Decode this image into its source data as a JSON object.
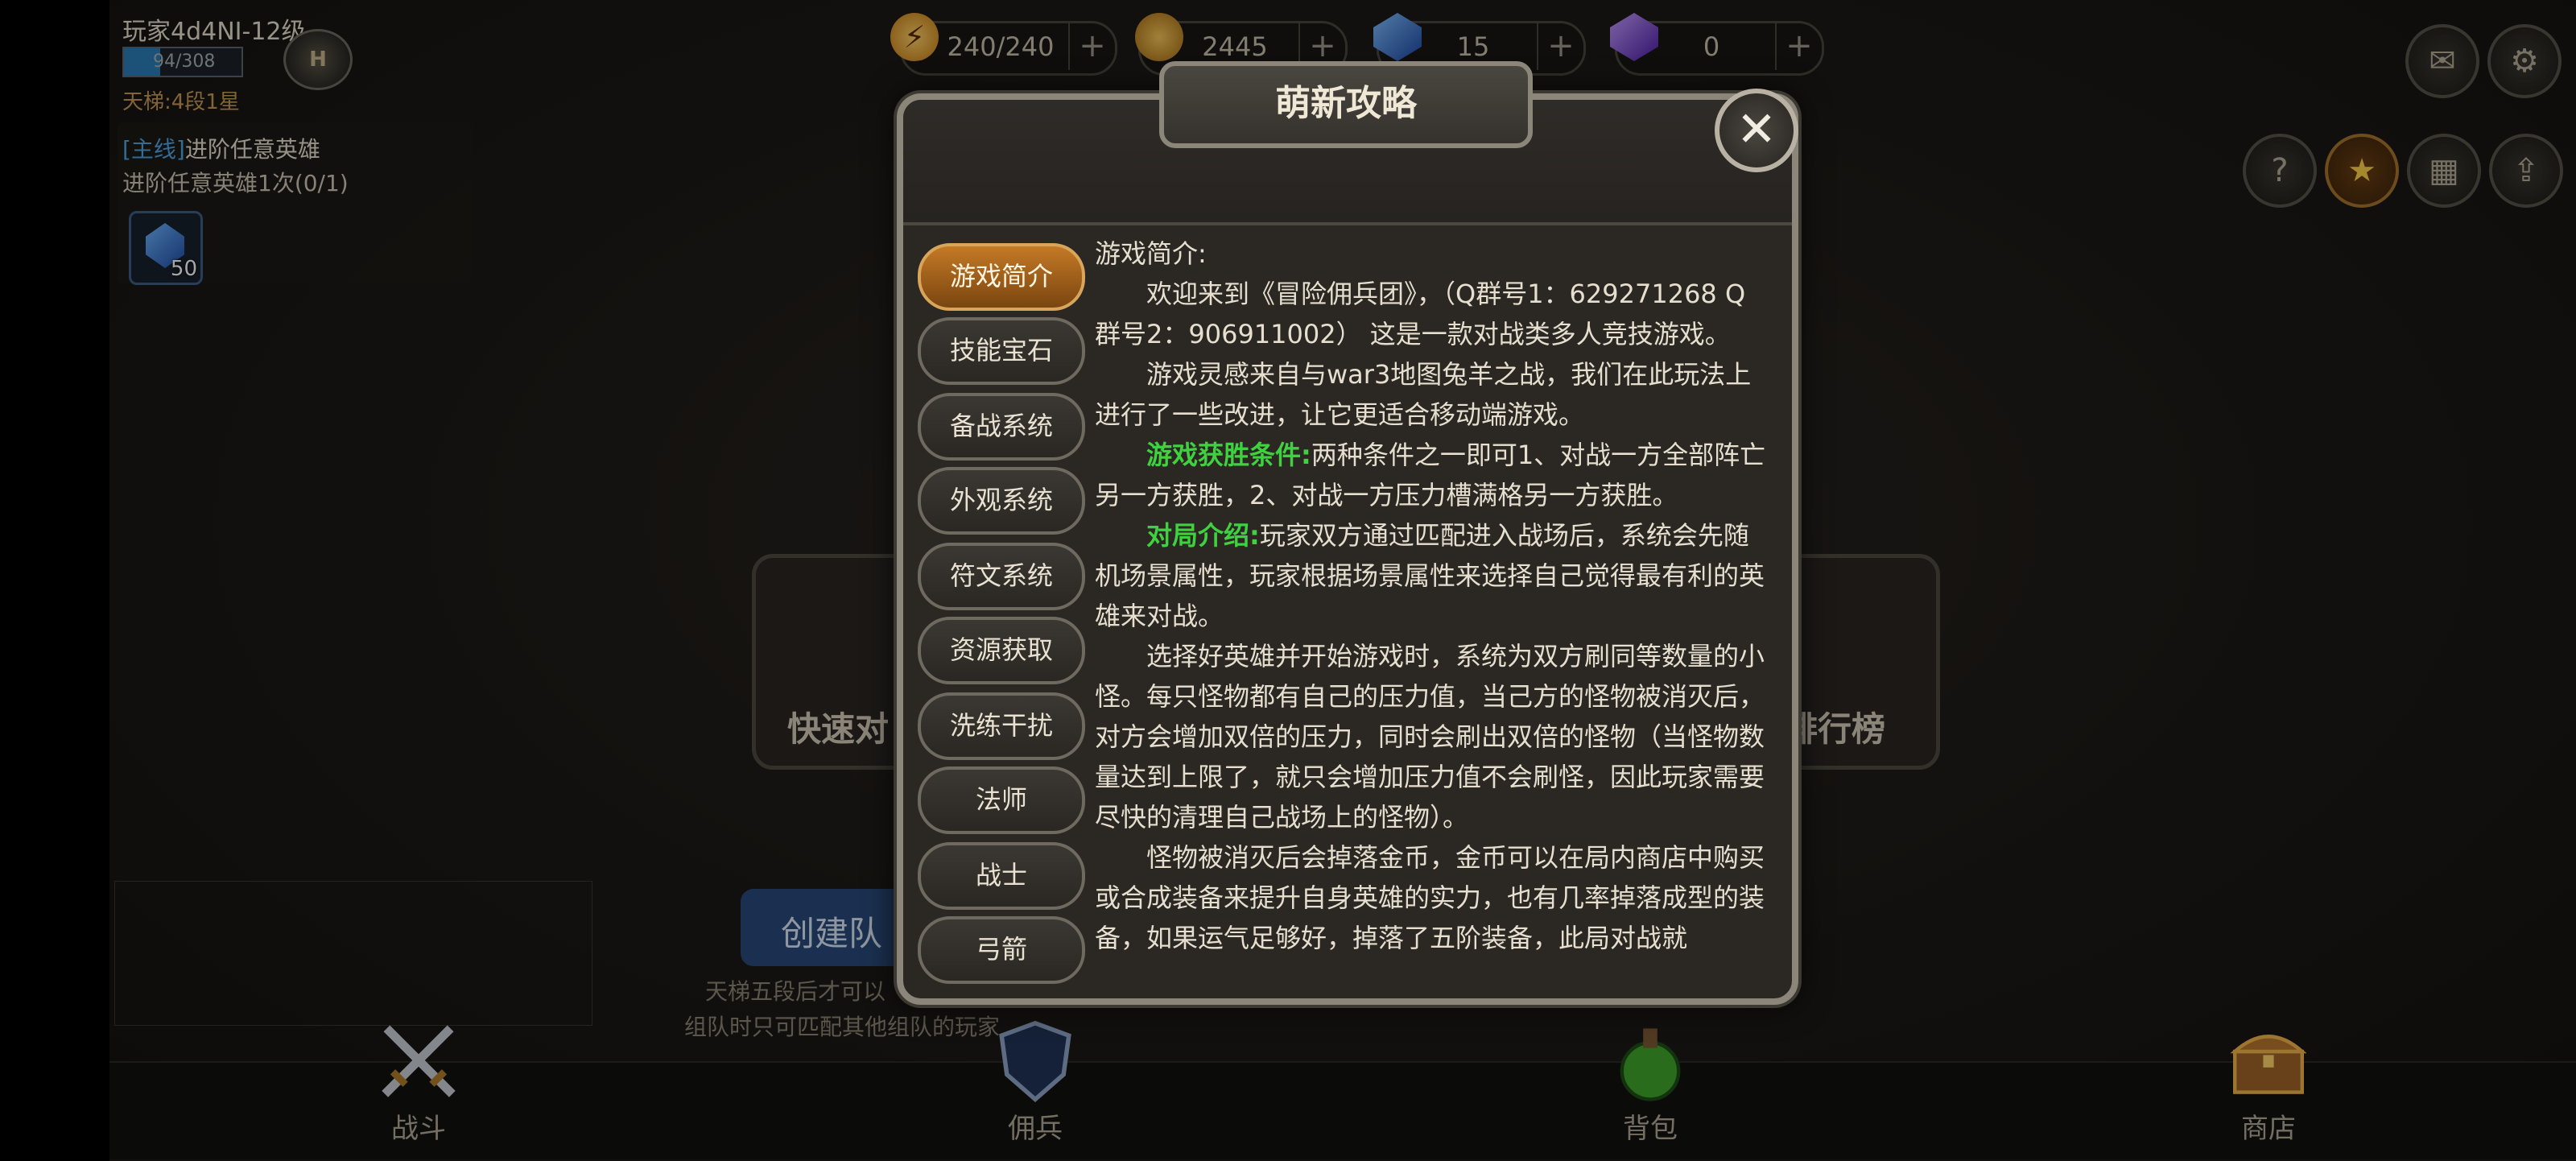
{
  "player": {
    "name": "玩家4d4NI-12级",
    "xp_text": "94/308",
    "xp_fraction": 0.305,
    "rank_badge": "H",
    "ladder": "天梯:4段1星"
  },
  "quest": {
    "tag": "[主线]",
    "title": "进阶任意英雄",
    "desc": "进阶任意英雄1次(0/1)",
    "reward_count": "50"
  },
  "resources": [
    {
      "icon": "energy-icon",
      "value": "240/240",
      "plus": "+"
    },
    {
      "icon": "gold-coin-icon",
      "value": "2445",
      "plus": "+"
    },
    {
      "icon": "blue-gem-icon",
      "value": "15",
      "plus": "+"
    },
    {
      "icon": "purple-gem-icon",
      "value": "0",
      "plus": "+"
    }
  ],
  "top_right_buttons": [
    "mail-icon",
    "settings-icon"
  ],
  "side_buttons": [
    "help-icon",
    "star-icon",
    "calendar-icon",
    "upgrade-icon"
  ],
  "help_glyph": "?",
  "background_tiles": {
    "quick_battle": "快速对",
    "ranking": "排行榜"
  },
  "team": {
    "create_label": "创建队",
    "hint1": "天梯五段后才可以",
    "hint2": "组队时只可匹配其他组队的玩家"
  },
  "bottom_nav": [
    {
      "label": "战斗",
      "icon": "crossed-swords-icon"
    },
    {
      "label": "佣兵",
      "icon": "shield-icon"
    },
    {
      "label": "背包",
      "icon": "potion-icon"
    },
    {
      "label": "商店",
      "icon": "treasure-chest-icon"
    }
  ],
  "dialog": {
    "title": "萌新攻略",
    "close": "✕",
    "tabs": [
      "游戏简介",
      "技能宝石",
      "备战系统",
      "外观系统",
      "符文系统",
      "资源获取",
      "洗练干扰",
      "法师",
      "战士",
      "弓箭"
    ],
    "active_tab": "游戏简介",
    "content": {
      "heading": "游戏简介:",
      "p1": "欢迎来到《冒险佣兵团》，（Q群号1：629271268 Q群号2：906911002） 这是一款对战类多人竞技游戏。",
      "p2": "游戏灵感来自与war3地图兔羊之战，我们在此玩法上进行了一些改进，让它更适合移动端游戏。",
      "p3_label": "游戏获胜条件:",
      "p3": "两种条件之一即可1、对战一方全部阵亡另一方获胜，2、对战一方压力槽满格另一方获胜。",
      "p4_label": "对局介绍:",
      "p4": "玩家双方通过匹配进入战场后，系统会先随机场景属性，玩家根据场景属性来选择自己觉得最有利的英雄来对战。",
      "p5": "选择好英雄并开始游戏时，系统为双方刷同等数量的小怪。每只怪物都有自己的压力值，当己方的怪物被消灭后，对方会增加双倍的压力，同时会刷出双倍的怪物（当怪物数量达到上限了，就只会增加压力值不会刷怪，因此玩家需要尽快的清理自己战场上的怪物）。",
      "p6": "怪物被消灭后会掉落金币，金币可以在局内商店中购买或合成装备来提升自身英雄的实力，也有几率掉落成型的装备，如果运气足够好，掉落了五阶装备，此局对战就"
    }
  }
}
